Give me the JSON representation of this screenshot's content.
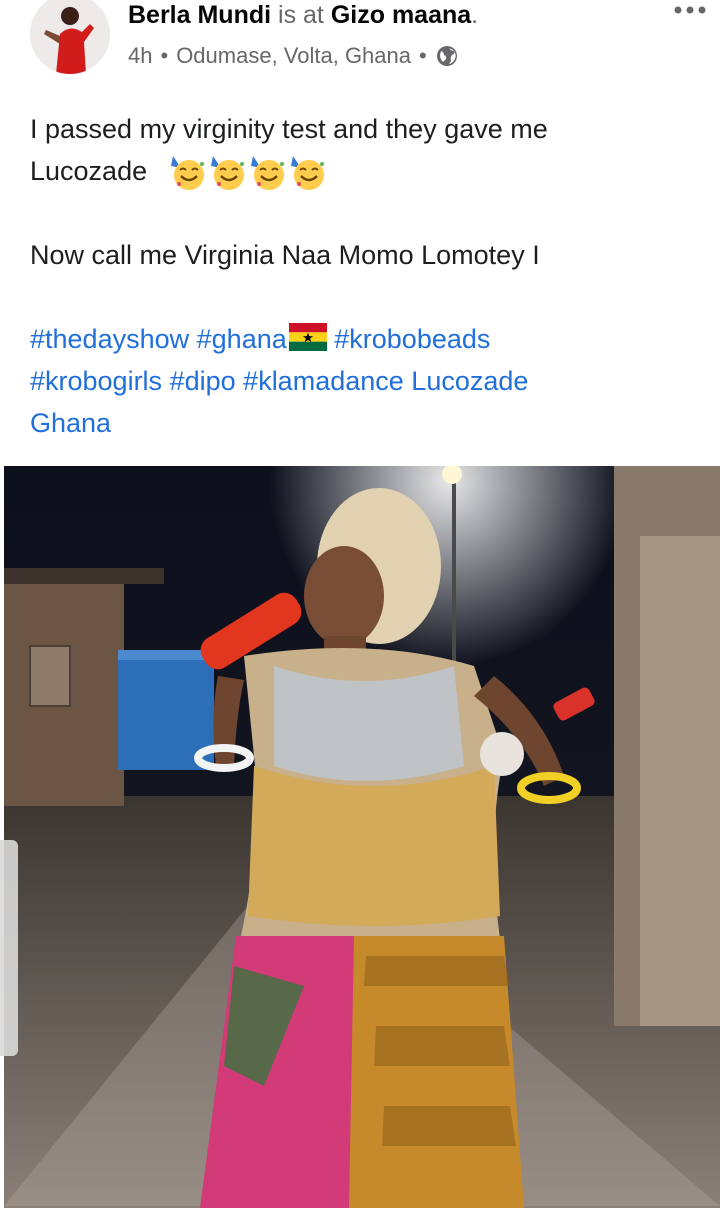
{
  "post": {
    "author": "Berla Mundi",
    "is_at": "is at",
    "place": "Gizo maana",
    "period": ".",
    "time": "4h",
    "location": "Odumase, Volta, Ghana",
    "separator": "•",
    "privacy_icon": "globe-icon",
    "more_icon": "more-options-icon",
    "text_line1": "I passed my virginity test and they gave me",
    "text_line2": "Lucozade",
    "emojis": [
      "partying-face",
      "partying-face",
      "partying-face",
      "partying-face"
    ],
    "text_line3": "Now call me Virginia Naa Momo Lomotey I",
    "hashtags": [
      "#thedayshow",
      "#ghana",
      "#krobobeads",
      "#krobogirls",
      "#dipo",
      "#klamadance",
      "Lucozade",
      "Ghana"
    ],
    "flag_icon": "ghana-flag-icon"
  },
  "colors": {
    "link": "#216fdb",
    "muted": "#65676b",
    "text": "#1c1e21"
  }
}
